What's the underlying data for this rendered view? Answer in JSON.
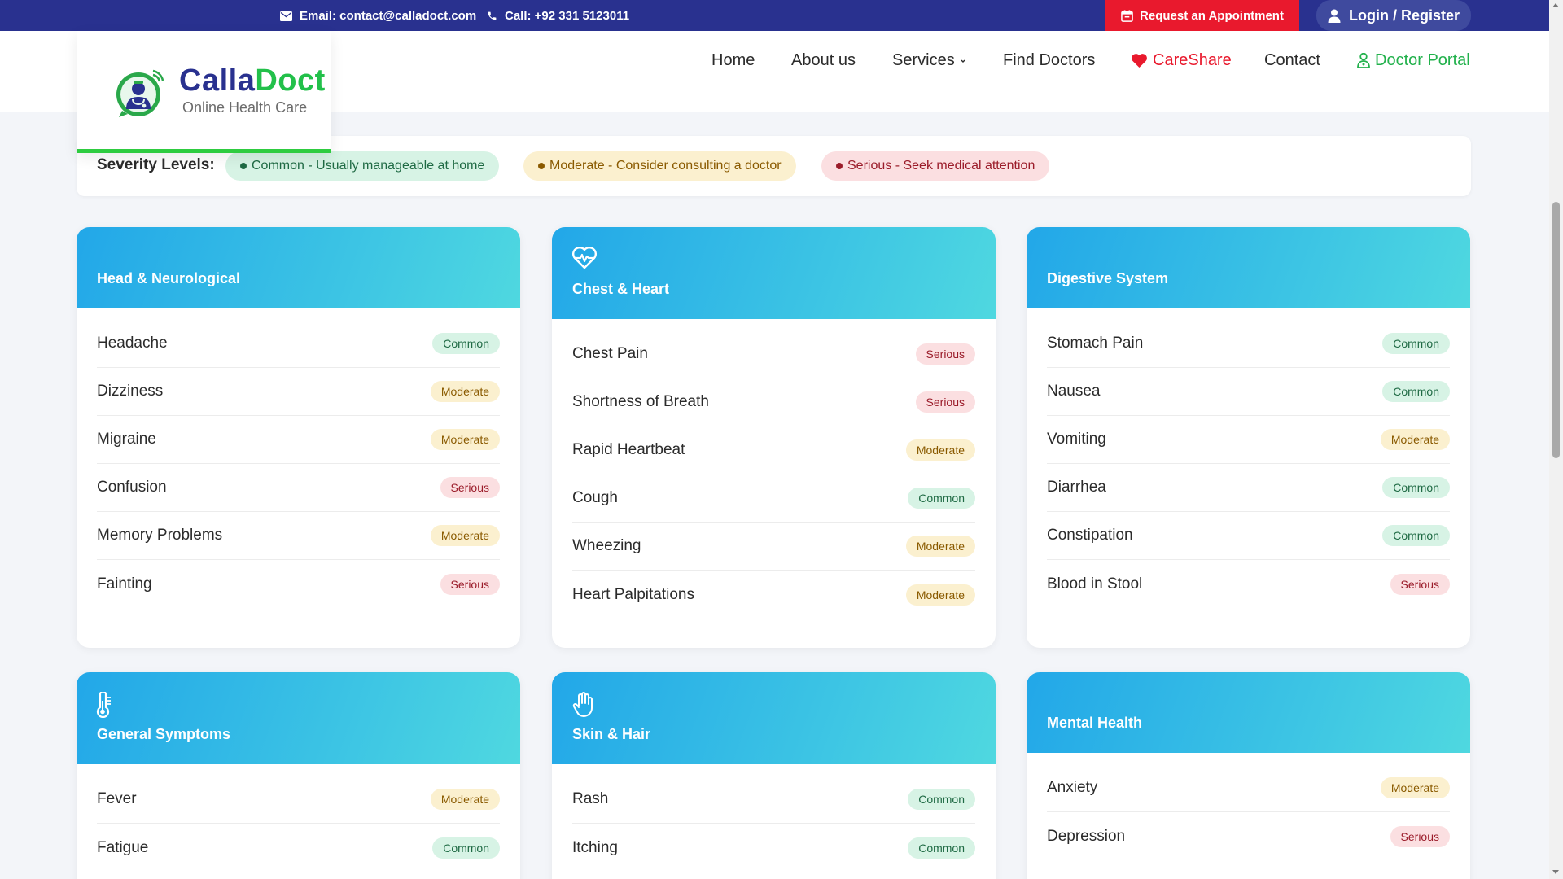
{
  "topbar": {
    "email": "Email: contact@calladoct.com",
    "call": "Call: +92 331 5123011",
    "appointment": "Request an Appointment",
    "login": "Login / Register"
  },
  "brand": {
    "name_part1": "Calla",
    "name_part2": "Doct",
    "tagline": "Online Health Care",
    "colors": {
      "primary": "#29318f",
      "accent": "#22c04a",
      "alert": "#e9192d"
    }
  },
  "nav": {
    "home": "Home",
    "about": "About us",
    "services": "Services",
    "find_doctors": "Find Doctors",
    "careshare": "CareShare",
    "contact": "Contact",
    "doctor_portal": "Doctor Portal"
  },
  "severity": {
    "title": "Severity Levels:",
    "common": "Common - Usually manageable at home",
    "moderate": "Moderate - Consider consulting a doctor",
    "serious": "Serious - Seek medical attention"
  },
  "cards": [
    {
      "title": "Head & Neurological",
      "icon": "",
      "items": [
        {
          "name": "Headache",
          "level": "Common"
        },
        {
          "name": "Dizziness",
          "level": "Moderate"
        },
        {
          "name": "Migraine",
          "level": "Moderate"
        },
        {
          "name": "Confusion",
          "level": "Serious"
        },
        {
          "name": "Memory Problems",
          "level": "Moderate"
        },
        {
          "name": "Fainting",
          "level": "Serious"
        }
      ]
    },
    {
      "title": "Chest & Heart",
      "icon": "heart-pulse-icon",
      "items": [
        {
          "name": "Chest Pain",
          "level": "Serious"
        },
        {
          "name": "Shortness of Breath",
          "level": "Serious"
        },
        {
          "name": "Rapid Heartbeat",
          "level": "Moderate"
        },
        {
          "name": "Cough",
          "level": "Common"
        },
        {
          "name": "Wheezing",
          "level": "Moderate"
        },
        {
          "name": "Heart Palpitations",
          "level": "Moderate"
        }
      ]
    },
    {
      "title": "Digestive System",
      "icon": "",
      "items": [
        {
          "name": "Stomach Pain",
          "level": "Common"
        },
        {
          "name": "Nausea",
          "level": "Common"
        },
        {
          "name": "Vomiting",
          "level": "Moderate"
        },
        {
          "name": "Diarrhea",
          "level": "Common"
        },
        {
          "name": "Constipation",
          "level": "Common"
        },
        {
          "name": "Blood in Stool",
          "level": "Serious"
        }
      ]
    },
    {
      "title": "General Symptoms",
      "icon": "thermometer-icon",
      "items": [
        {
          "name": "Fever",
          "level": "Moderate"
        },
        {
          "name": "Fatigue",
          "level": "Common"
        }
      ]
    },
    {
      "title": "Skin & Hair",
      "icon": "hand-icon",
      "items": [
        {
          "name": "Rash",
          "level": "Common"
        },
        {
          "name": "Itching",
          "level": "Common"
        }
      ]
    },
    {
      "title": "Mental Health",
      "icon": "",
      "items": [
        {
          "name": "Anxiety",
          "level": "Moderate"
        },
        {
          "name": "Depression",
          "level": "Serious"
        }
      ]
    }
  ]
}
